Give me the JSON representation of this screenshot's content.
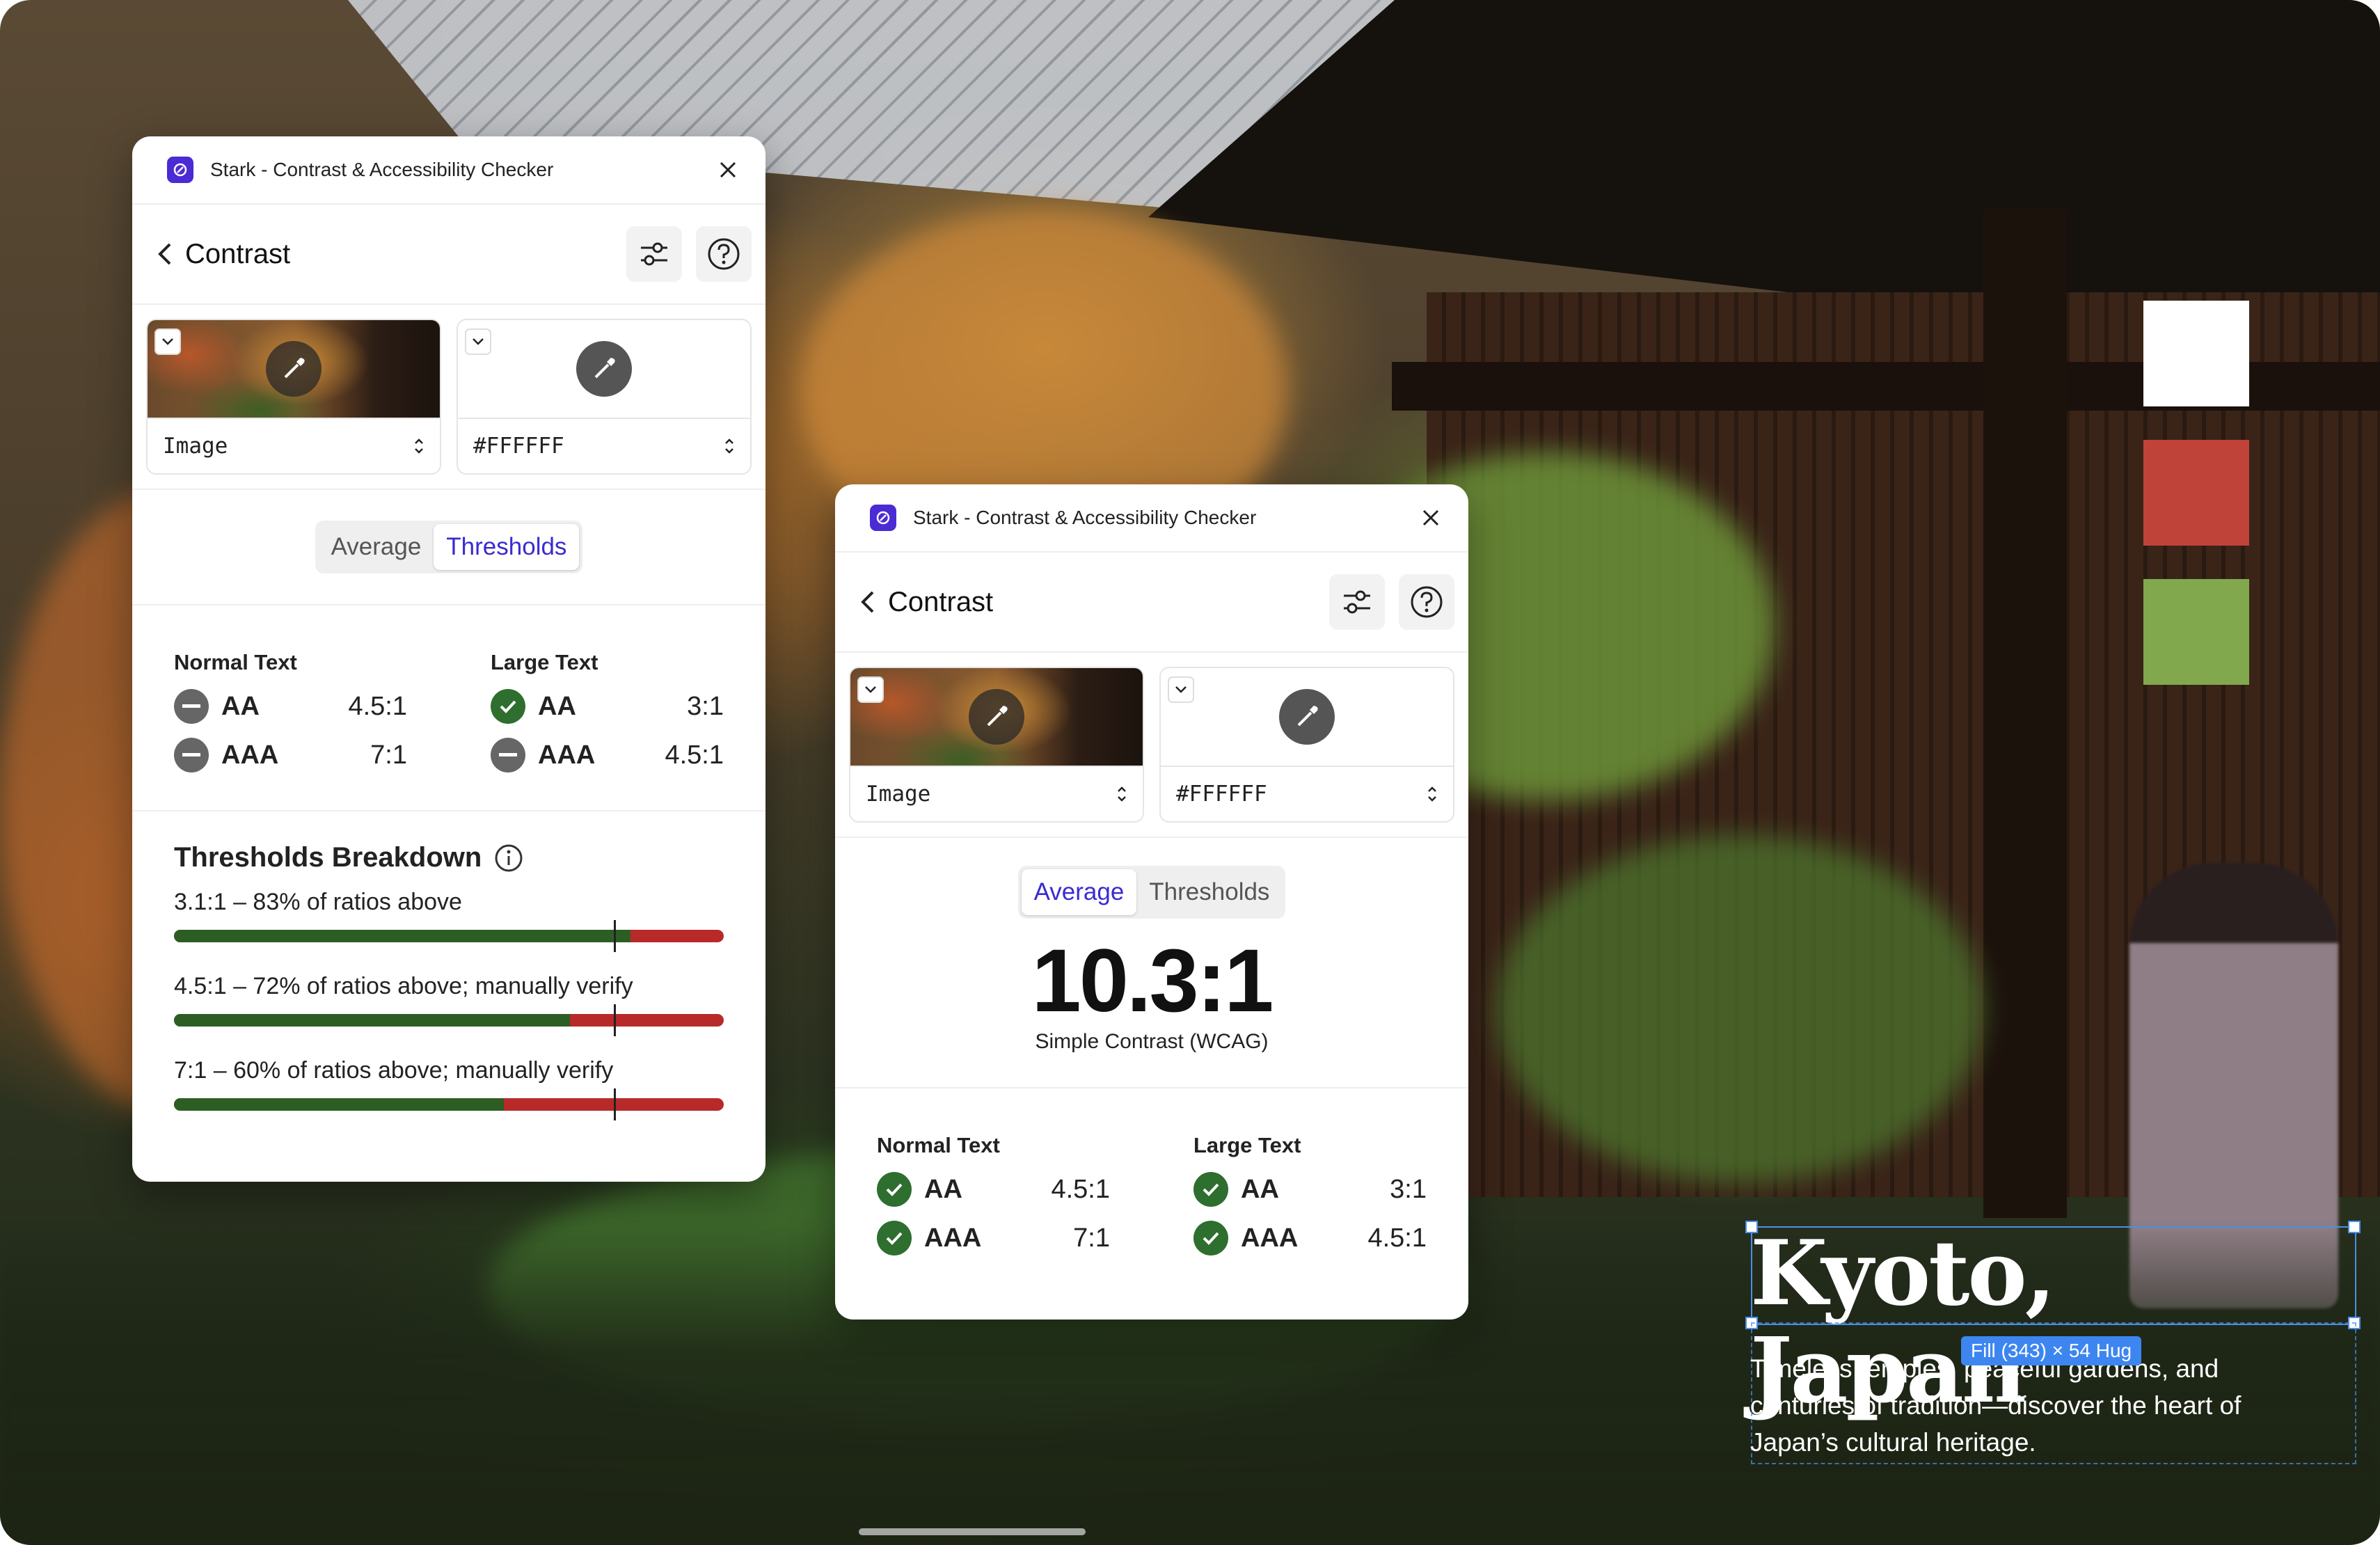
{
  "colors": {
    "accent": "#3A2BD0",
    "pass": "#2E6E2E",
    "fail": "#B82A2A",
    "fill": "#2C5E24"
  },
  "palette": [
    "#FFFFFF",
    "#C0433A",
    "#82A84E"
  ],
  "poster": {
    "title": "Kyoto, Japan",
    "description": "Timeless temples, peaceful gardens, and centuries of tradition—discover the heart of Japan’s cultural heritage.",
    "selection_badge": "Fill (343) × 54 Hug"
  },
  "panel1": {
    "app_title": "Stark - Contrast & Accessibility Checker",
    "nav_title": "Contrast",
    "fg_picker": {
      "value": "Image"
    },
    "bg_picker": {
      "value": "#FFFFFF"
    },
    "tabs": [
      "Average",
      "Thresholds"
    ],
    "active_tab": "Thresholds",
    "normal_text": {
      "heading": "Normal Text",
      "aa": {
        "label": "AA",
        "ratio": "4.5:1",
        "status": "neutral"
      },
      "aaa": {
        "label": "AAA",
        "ratio": "7:1",
        "status": "neutral"
      }
    },
    "large_text": {
      "heading": "Large Text",
      "aa": {
        "label": "AA",
        "ratio": "3:1",
        "status": "pass"
      },
      "aaa": {
        "label": "AAA",
        "ratio": "4.5:1",
        "status": "neutral"
      }
    },
    "breakdown": {
      "title": "Thresholds Breakdown",
      "items": [
        {
          "label": "3.1:1 – 83% of ratios above",
          "percent": 83
        },
        {
          "label": "4.5:1 – 72% of ratios above; manually verify",
          "percent": 72
        },
        {
          "label": "7:1 – 60% of ratios above; manually verify",
          "percent": 60
        }
      ]
    }
  },
  "panel2": {
    "app_title": "Stark - Contrast & Accessibility Checker",
    "nav_title": "Contrast",
    "fg_picker": {
      "value": "Image"
    },
    "bg_picker": {
      "value": "#FFFFFF"
    },
    "tabs": [
      "Average",
      "Thresholds"
    ],
    "active_tab": "Average",
    "ratio": "10.3:1",
    "ratio_caption": "Simple Contrast (WCAG)",
    "normal_text": {
      "heading": "Normal Text",
      "aa": {
        "label": "AA",
        "ratio": "4.5:1",
        "status": "pass"
      },
      "aaa": {
        "label": "AAA",
        "ratio": "7:1",
        "status": "pass"
      }
    },
    "large_text": {
      "heading": "Large Text",
      "aa": {
        "label": "AA",
        "ratio": "3:1",
        "status": "pass"
      },
      "aaa": {
        "label": "AAA",
        "ratio": "4.5:1",
        "status": "pass"
      }
    }
  }
}
